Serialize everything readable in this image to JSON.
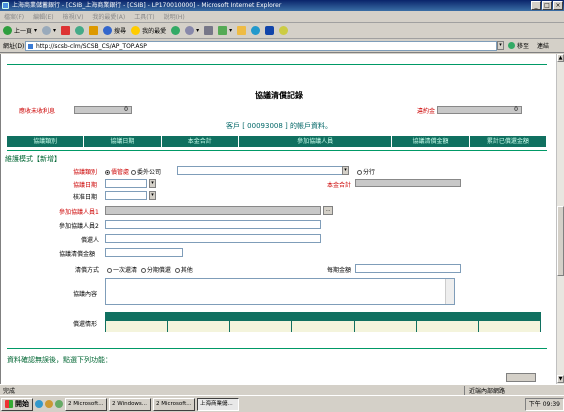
{
  "window": {
    "title": "上海商業儲蓄銀行 - [CSIB_上海商業銀行 - [CSIB] - LP170010000] - Microsoft Internet Explorer"
  },
  "menubar": [
    "檔案(F)",
    "編輯(E)",
    "檢視(V)",
    "我的最愛(A)",
    "工具(T)",
    "說明(H)"
  ],
  "toolbar": {
    "back": "上一頁",
    "search": "搜尋",
    "favorites": "我的最愛"
  },
  "address": {
    "label": "網址(D)",
    "url": "http://scsb-clm/SCSB_CS/AP_TOP.ASP",
    "go": "移至",
    "links": "連結"
  },
  "page": {
    "title": "協議清償記錄",
    "left_label": "應收未收利息",
    "left_value": "0",
    "right_label": "違約金",
    "right_value": "0",
    "account_line": "客戶 [ 00093008 ] 的帳戶資料。",
    "table_headers": [
      "協議類別",
      "協議日期",
      "本金合計",
      "參加協議人員",
      "協議清償金額",
      "累計已償還金額"
    ],
    "mode": "維護模式【新增】",
    "form": {
      "category_label": "協議類別",
      "category_opt1": "債管處",
      "category_opt2": "委外公司",
      "branch_opt": "分行",
      "date_label": "協議日期",
      "principal_total_label": "本金合計",
      "approve_date_label": "核准日期",
      "participant1_label": "參加協議人員1",
      "participant2_label": "參加協議人員2",
      "repayer_label": "償還人",
      "amount_label": "協議清償金額",
      "method_label": "清償方式",
      "method_opt1": "一次還清",
      "method_opt2": "分期償還",
      "method_opt3": "其他",
      "period_amount_label": "每期金額",
      "content_label": "協議內容",
      "repay_status_label": "償還情形"
    },
    "footer_note": "資料確認無誤後，點選下列功能："
  },
  "statusbar": {
    "text": "完成",
    "zone": "近端內部網路"
  },
  "taskbar": {
    "start": "開始",
    "tasks": [
      "2 Microsoft...",
      "2 Windows...",
      "2 Microsoft...",
      "上海商業儲..."
    ],
    "clock": "下午 09:39"
  }
}
